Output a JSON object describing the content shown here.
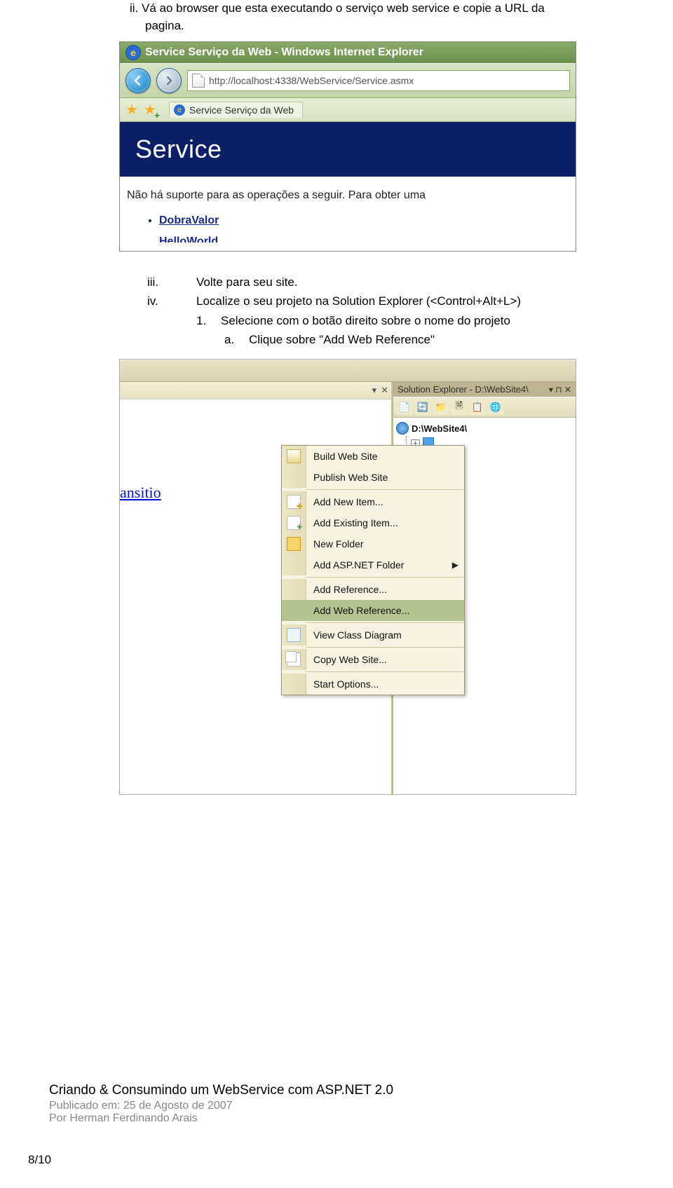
{
  "steps": {
    "ii_label": "ii.",
    "ii_text_a": "Vá ao browser que esta executando o serviço web service e copie a URL da",
    "ii_text_b": "pagina.",
    "iii_label": "iii.",
    "iii_text": "Volte para seu site.",
    "iv_label": "iv.",
    "iv_text": "Localize o seu projeto na Solution Explorer (<Control+Alt+L>)",
    "one_label": "1.",
    "one_text": "Selecione com o botão direito sobre o nome do projeto",
    "a_label": "a.",
    "a_text": "Clique sobre \"Add Web Reference\""
  },
  "ie": {
    "title": "Service Serviço da Web - Windows Internet Explorer",
    "url": "http://localhost:4338/WebService/Service.asmx",
    "tab_label": "Service Serviço da Web",
    "page_heading": "Service",
    "description": "Não há suporte para as operações a seguir. Para obter uma",
    "links": [
      "DobraValor",
      "HelloWorld"
    ]
  },
  "vs": {
    "link_fragment": "ansitio",
    "pane_title": "Solution Explorer - D:\\WebSite4\\",
    "project": "D:\\WebSite4\\",
    "pin_icon": "▾   ⊓   ✕",
    "menu": [
      {
        "label": "Build Web Site",
        "icon": "build"
      },
      {
        "label": "Publish Web Site",
        "icon": ""
      },
      {
        "separator": true
      },
      {
        "label": "Add New Item...",
        "icon": "newitem"
      },
      {
        "label": "Add Existing Item...",
        "icon": "existing"
      },
      {
        "label": "New Folder",
        "icon": "folder"
      },
      {
        "label": "Add ASP.NET Folder",
        "icon": "",
        "arrow": true
      },
      {
        "separator": true
      },
      {
        "label": "Add Reference...",
        "icon": ""
      },
      {
        "label": "Add Web Reference...",
        "icon": "",
        "selected": true
      },
      {
        "separator": true
      },
      {
        "label": "View Class Diagram",
        "icon": "view"
      },
      {
        "separator": true
      },
      {
        "label": "Copy Web Site...",
        "icon": "copy"
      },
      {
        "separator": true
      },
      {
        "label": "Start Options...",
        "icon": ""
      }
    ]
  },
  "footer": {
    "title": "Criando & Consumindo um WebService com ASP.NET 2.0",
    "published": "Publicado em: 25 de Agosto de 2007",
    "author": "Por Herman Ferdinando Arais",
    "page": "8/10"
  }
}
